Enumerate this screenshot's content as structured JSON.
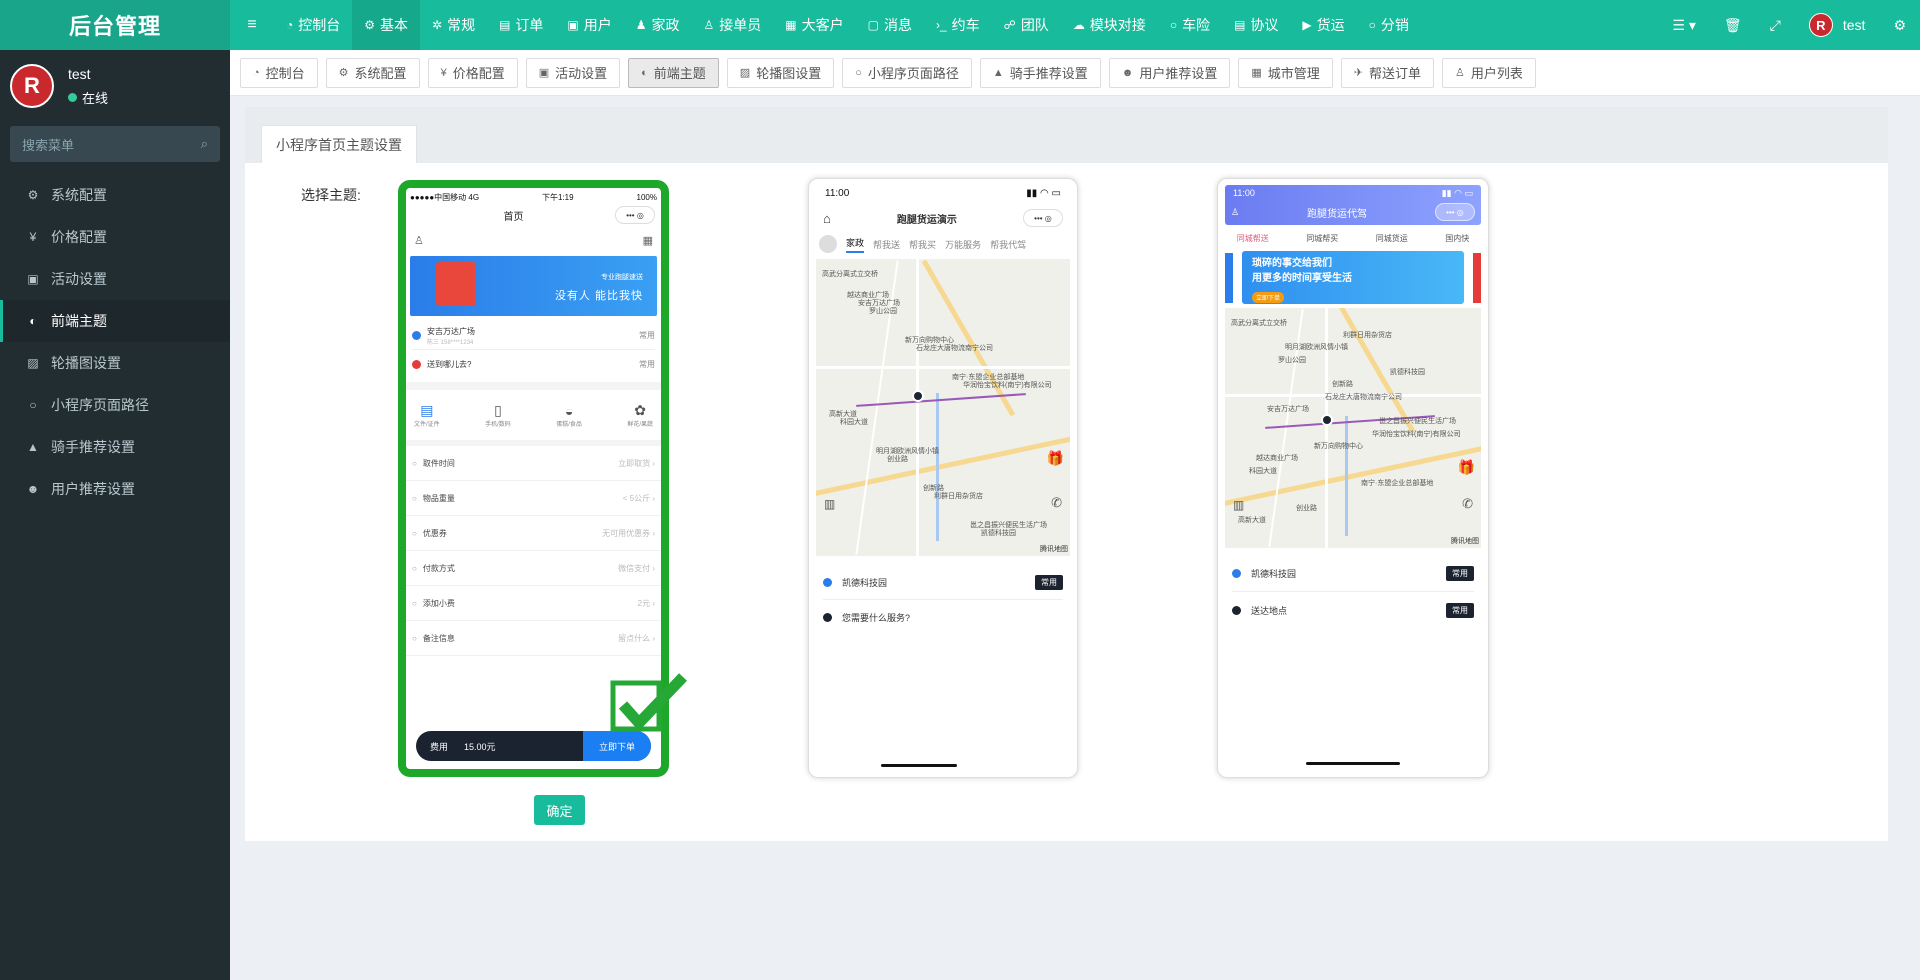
{
  "app": {
    "logo": "后台管理"
  },
  "user": {
    "name": "test",
    "status": "在线",
    "avatar_initial": "R"
  },
  "sidebar": {
    "search_placeholder": "搜索菜单",
    "items": [
      {
        "label": "系统配置",
        "icon": "gear-icon",
        "glyph": "⚙"
      },
      {
        "label": "价格配置",
        "icon": "yen-icon",
        "glyph": "¥"
      },
      {
        "label": "活动设置",
        "icon": "gift-icon",
        "glyph": "▣"
      },
      {
        "label": "前端主题",
        "icon": "palette-icon",
        "glyph": "◐",
        "active": true
      },
      {
        "label": "轮播图设置",
        "icon": "image-icon",
        "glyph": "▨"
      },
      {
        "label": "小程序页面路径",
        "icon": "circle-icon",
        "glyph": "○"
      },
      {
        "label": "骑手推荐设置",
        "icon": "lock-icon",
        "glyph": "▲"
      },
      {
        "label": "用户推荐设置",
        "icon": "users-icon",
        "glyph": "☻"
      }
    ]
  },
  "topnav": {
    "items": [
      {
        "label": "控制台",
        "icon": "dashboard-icon",
        "glyph": "◔"
      },
      {
        "label": "基本",
        "icon": "gear-icon",
        "glyph": "⚙",
        "active": true
      },
      {
        "label": "常规",
        "icon": "gears-icon",
        "glyph": "✲"
      },
      {
        "label": "订单",
        "icon": "book-icon",
        "glyph": "▤"
      },
      {
        "label": "用户",
        "icon": "user-card-icon",
        "glyph": "▣"
      },
      {
        "label": "家政",
        "icon": "walk-icon",
        "glyph": "♟"
      },
      {
        "label": "接单员",
        "icon": "user-icon",
        "glyph": "♙"
      },
      {
        "label": "大客户",
        "icon": "id-card-icon",
        "glyph": "▦"
      },
      {
        "label": "消息",
        "icon": "message-icon",
        "glyph": "▢"
      },
      {
        "label": "约车",
        "icon": "terminal-icon",
        "glyph": "›_"
      },
      {
        "label": "团队",
        "icon": "handshake-icon",
        "glyph": "☍"
      },
      {
        "label": "模块对接",
        "icon": "cloud-icon",
        "glyph": "☁"
      },
      {
        "label": "车险",
        "icon": "circle-icon",
        "glyph": "○"
      },
      {
        "label": "协议",
        "icon": "list-icon",
        "glyph": "▤"
      },
      {
        "label": "货运",
        "icon": "truck-icon",
        "glyph": "▶"
      },
      {
        "label": "分销",
        "icon": "circle-icon",
        "glyph": "○"
      }
    ],
    "right": {
      "user": "test"
    }
  },
  "tabs": [
    {
      "label": "控制台",
      "icon": "dashboard-icon",
      "glyph": "◔"
    },
    {
      "label": "系统配置",
      "icon": "gear-icon",
      "glyph": "⚙"
    },
    {
      "label": "价格配置",
      "icon": "yen-icon",
      "glyph": "¥"
    },
    {
      "label": "活动设置",
      "icon": "gift-icon",
      "glyph": "▣"
    },
    {
      "label": "前端主题",
      "icon": "palette-icon",
      "glyph": "◐",
      "active": true
    },
    {
      "label": "轮播图设置",
      "icon": "image-icon",
      "glyph": "▨"
    },
    {
      "label": "小程序页面路径",
      "icon": "circle-icon",
      "glyph": "○"
    },
    {
      "label": "骑手推荐设置",
      "icon": "lock-icon",
      "glyph": "▲"
    },
    {
      "label": "用户推荐设置",
      "icon": "users-icon",
      "glyph": "☻"
    },
    {
      "label": "城市管理",
      "icon": "building-icon",
      "glyph": "▦"
    },
    {
      "label": "帮送订单",
      "icon": "plane-icon",
      "glyph": "✈"
    },
    {
      "label": "用户列表",
      "icon": "user-icon",
      "glyph": "♙"
    }
  ],
  "content": {
    "panel_tab": "小程序首页主题设置",
    "select_label": "选择主题:",
    "confirm_button": "确定"
  },
  "themes": {
    "theme1": {
      "selected": true,
      "status_left": "●●●●●中国移动 4G",
      "status_time": "下午1:19",
      "status_right": "100%",
      "title": "首页",
      "banner_title": "专业跑腿速送",
      "banner_sub": "没有人 能比我快",
      "from_address": "安吉万达广场",
      "from_contact": "陈三 158****1234",
      "to_address": "送到哪儿去?",
      "tag": "常用",
      "categories": [
        "文件/证件",
        "手机/数码",
        "蛋糕/食品",
        "鲜花/果蔬"
      ],
      "options": [
        {
          "label": "取件时间",
          "value": "立即取货"
        },
        {
          "label": "物品重量",
          "value": "< 5公斤"
        },
        {
          "label": "优惠券",
          "value": "无可用优惠券"
        },
        {
          "label": "付款方式",
          "value": "微信支付"
        },
        {
          "label": "添加小费",
          "value": "2元"
        },
        {
          "label": "备注信息",
          "value": "留点什么"
        }
      ],
      "fee_label": "费用",
      "fee_value": "15.00元",
      "order_button": "立即下单"
    },
    "theme2": {
      "status_time": "11:00",
      "title": "跑腿货运演示",
      "tabs": [
        "家政",
        "帮我送",
        "帮我买",
        "万能服务",
        "帮我代驾"
      ],
      "address_1": "凯德科技园",
      "address_2": "您需要什么服务?",
      "tag": "常用",
      "map_credit": "腾讯地图"
    },
    "theme3": {
      "status_time": "11:00",
      "title": "跑腿货运代驾",
      "tabs": [
        "同城帮送",
        "同城帮买",
        "同城货运",
        "国内快"
      ],
      "banner_title": "琐碎的事交给我们",
      "banner_sub": "用更多的时间享受生活",
      "banner_button": "立即下单",
      "address_1": "凯德科技园",
      "address_2": "送达地点",
      "tag": "常用",
      "map_credit": "腾讯地图"
    }
  },
  "map_labels": [
    "高武分离式立交桥",
    "罗山公园",
    "石龙庄大唐物流南宁公司",
    "华润怡宝饮料(南宁)有限公司",
    "科园大道",
    "创业路",
    "利群日用杂货店",
    "凯德科技园",
    "安吉万达广场",
    "新万向购物中心",
    "南宁·东盟企业总部基地",
    "高新大道",
    "明月湖欧洲风情小镇",
    "创新路",
    "邕之昌振兴便民生活广场",
    "越达商业广场"
  ],
  "colors": {
    "accent": "#18bc9c",
    "sidebar": "#222d32",
    "selected_border": "#1ea82a",
    "check": "#27a836"
  }
}
